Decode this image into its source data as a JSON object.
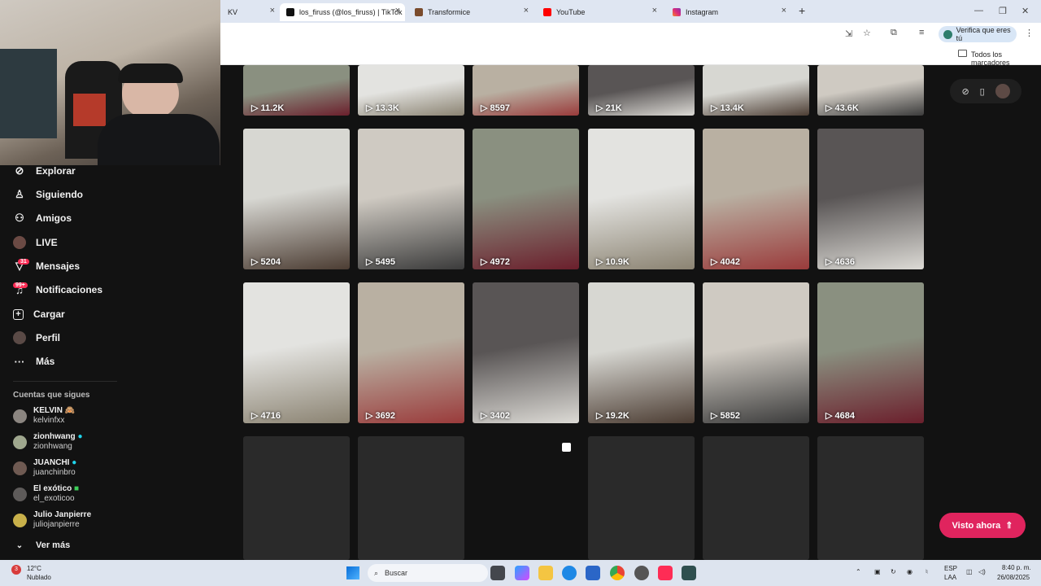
{
  "browser": {
    "tabs": [
      {
        "label": "KV"
      },
      {
        "label": "los_firuss (@los_firuss) | TikTok"
      },
      {
        "label": "Transformice"
      },
      {
        "label": "YouTube"
      },
      {
        "label": "Instagram"
      }
    ],
    "new_tab": "+",
    "verify_label": "Verifica que eres tú",
    "bookmarks_label": "Todos los marcadores",
    "window_controls": [
      "—",
      "❐",
      "✕"
    ]
  },
  "sidebar": {
    "nav": [
      {
        "label": "Explorar",
        "icon": "compass-icon"
      },
      {
        "label": "Siguiendo",
        "icon": "user-icon"
      },
      {
        "label": "Amigos",
        "icon": "friends-icon"
      },
      {
        "label": "LIVE",
        "icon": "live-icon"
      },
      {
        "label": "Mensajes",
        "icon": "message-icon",
        "badge": "31"
      },
      {
        "label": "Notificaciones",
        "icon": "bell-icon",
        "badge": "99+"
      },
      {
        "label": "Cargar",
        "icon": "plus-icon"
      },
      {
        "label": "Perfil",
        "icon": "avatar-icon"
      },
      {
        "label": "Más",
        "icon": "more-icon"
      }
    ],
    "following_title": "Cuentas que sigues",
    "accounts": [
      {
        "name": "KELVIN 🙈",
        "handle": "kelvinfxx"
      },
      {
        "name": "zionhwang",
        "handle": "zionhwang"
      },
      {
        "name": "JUANCHI",
        "handle": "juanchinbro"
      },
      {
        "name": "El exótico",
        "handle": "el_exoticoo"
      },
      {
        "name": "Julio Janpierre",
        "handle": "juliojanpierre"
      }
    ],
    "see_more": "Ver más"
  },
  "grid": {
    "top_row": [
      "11.2K",
      "13.3K",
      "8597",
      "21K",
      "13.4K",
      "43.6K"
    ],
    "row1": [
      "5204",
      "5495",
      "4972",
      "10.9K",
      "4042",
      "4636"
    ],
    "row2": [
      "4716",
      "3692",
      "3402",
      "19.2K",
      "5852",
      "4684"
    ]
  },
  "visto_ahora": "Visto ahora",
  "taskbar": {
    "weather_temp": "12°C",
    "weather_desc": "Nublado",
    "weather_badge": "3",
    "search_placeholder": "Buscar",
    "lang1": "ESP",
    "lang2": "LAA",
    "time": "8:40 p. m.",
    "date": "26/08/2025"
  },
  "colors": {
    "accent": "#fe2c55",
    "background": "#121212",
    "visto_button": "#e0245e"
  }
}
